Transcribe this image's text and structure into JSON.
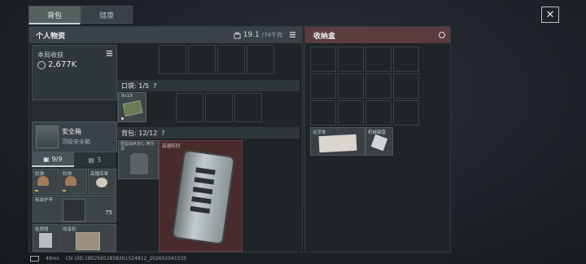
{
  "tabs": [
    {
      "label": "背包",
      "active": true
    },
    {
      "label": "健康",
      "active": false
    }
  ],
  "personal": {
    "title": "个人物资",
    "weight": "19.1",
    "weight_unit": "/74千克"
  },
  "earnings": {
    "label": "本局收获",
    "value": "2,677K"
  },
  "safe_box": {
    "name": "安全箱",
    "subtitle": "顶级安全箱"
  },
  "equip_tabs": [
    {
      "label": "9/9",
      "active": true,
      "icon": "backpack-icon"
    },
    {
      "label": "3",
      "active": false,
      "icon": "trash-icon"
    }
  ],
  "equip_slots": {
    "helmet1": "防弹",
    "helmet2": "防弹",
    "headset": "高播耳罩",
    "armor": "标准护甲",
    "armor_value": "75",
    "scanner": "处理器",
    "radio": "收音机"
  },
  "pocket": {
    "label": "口袋: 1/5",
    "help": "?",
    "ammo_label": "9x19"
  },
  "backpack": {
    "label": "背包: 12/12",
    "help": "?",
    "vest_label": "轻型战术背心 阿尔法",
    "pack_label": "高速阵列"
  },
  "storage": {
    "title": "收纳盒",
    "item1": "运货单",
    "item2": "机械键盘"
  },
  "status": {
    "ping": "49ms",
    "uid": "CN UID:1802565285826152481​2_202602041535"
  }
}
